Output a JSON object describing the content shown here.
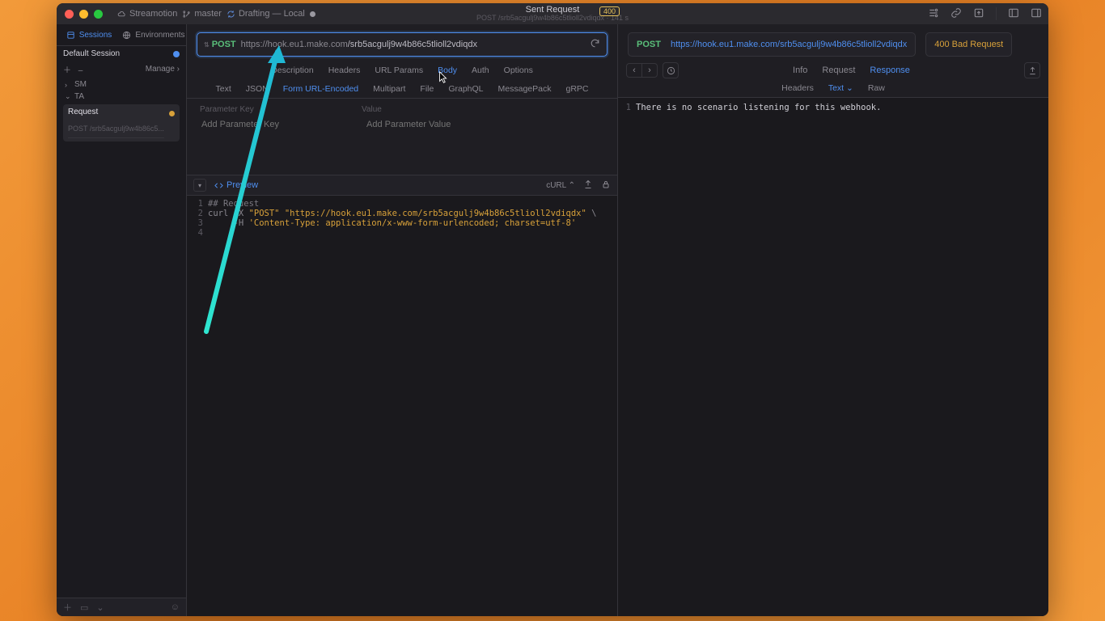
{
  "titlebar": {
    "workspace": "Streamotion",
    "branch": "master",
    "draft": "Drafting — Local",
    "title": "Sent Request",
    "subtitle": "POST /srb5acgulj9w4b86c5tlioll2vdiqdx · 141 s",
    "badge": "400"
  },
  "sidebar": {
    "tabs": {
      "sessions": "Sessions",
      "environments": "Environments"
    },
    "session_label": "Default Session",
    "manage": "Manage",
    "folders": [
      {
        "label": "SM",
        "open": false
      },
      {
        "label": "TA",
        "open": true
      }
    ],
    "request": {
      "title": "Request",
      "subtitle": "POST /srb5acgulj9w4b86c5..."
    }
  },
  "url": {
    "method": "POST",
    "host": "https://hook.eu1.make.com",
    "path": "/srb5acgulj9w4b86c5tlioll2vdiqdx"
  },
  "req_tabs": [
    "Description",
    "Headers",
    "URL Params",
    "Body",
    "Auth",
    "Options"
  ],
  "req_tab_active": 3,
  "body_tabs": [
    "Text",
    "JSON",
    "Form URL-Encoded",
    "Multipart",
    "File",
    "GraphQL",
    "MessagePack",
    "gRPC"
  ],
  "body_tab_active": 2,
  "param_header": {
    "key": "Parameter Key",
    "value": "Value"
  },
  "param_placeholder": {
    "key": "Add Parameter Key",
    "value": "Add Parameter Value"
  },
  "preview": {
    "label": "Preview",
    "curl": "cURL"
  },
  "code": [
    {
      "n": "1",
      "cls": "cmt",
      "t": "## Request"
    },
    {
      "n": "2",
      "cls": "",
      "t": "curl -X \"POST\" \"https://hook.eu1.make.com/srb5acgulj9w4b86c5tlioll2vdiqdx\" \\"
    },
    {
      "n": "3",
      "cls": "",
      "t": "     -H 'Content-Type: application/x-www-form-urlencoded; charset=utf-8'"
    },
    {
      "n": "4",
      "cls": "",
      "t": ""
    }
  ],
  "resp": {
    "method": "POST",
    "url": "https://hook.eu1.make.com/srb5acgulj9w4b86c5tlioll2vdiqdx",
    "status": "400 Bad Request",
    "tabs": [
      "Info",
      "Request",
      "Response"
    ],
    "tab_active": 2,
    "subtabs": [
      "Headers",
      "Text",
      "Raw"
    ],
    "subtab_active": 1,
    "body": "There is no scenario listening for this webhook."
  }
}
